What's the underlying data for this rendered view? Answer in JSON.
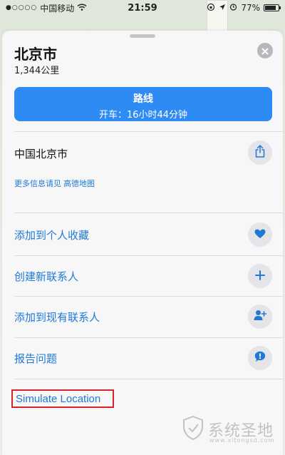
{
  "status_bar": {
    "signal_dots": "●○○○○",
    "carrier": "中国移动",
    "time": "21:59",
    "battery": "77%",
    "battery_level": 0.77
  },
  "place": {
    "title": "北京市",
    "distance": "1,344公里"
  },
  "route_button": {
    "label": "路线",
    "detail": "开车：16小时44分钟"
  },
  "address": "中国北京市",
  "more_info": {
    "prefix": "更多信息请见",
    "provider": "高德地图"
  },
  "actions": [
    {
      "label": "添加到个人收藏",
      "icon": "heart-icon"
    },
    {
      "label": "创建新联系人",
      "icon": "plus-icon"
    },
    {
      "label": "添加到现有联系人",
      "icon": "add-contact-icon"
    },
    {
      "label": "报告问题",
      "icon": "exclamation-bubble-icon"
    }
  ],
  "simulate_location": "Simulate Location",
  "watermark": {
    "text": "系统圣地",
    "url": "www.xitongsd.com"
  },
  "colors": {
    "accent": "#1f7ad6",
    "route_button": "#2e8bf3",
    "highlight_border": "#d9222b"
  }
}
